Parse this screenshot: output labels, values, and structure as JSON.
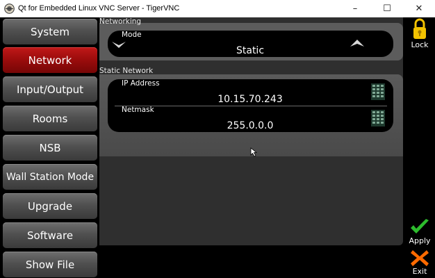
{
  "window": {
    "title": "Qt for Embedded Linux VNC Server - TigerVNC",
    "minimize": "–",
    "maximize": "☐",
    "close": "✕"
  },
  "nav": [
    {
      "label": "System",
      "active": false
    },
    {
      "label": "Network",
      "active": true
    },
    {
      "label": "Input/Output",
      "active": false
    },
    {
      "label": "Rooms",
      "active": false
    },
    {
      "label": "NSB",
      "active": false
    },
    {
      "label": "Wall Station Mode",
      "active": false
    },
    {
      "label": "Upgrade",
      "active": false
    },
    {
      "label": "Software",
      "active": false
    },
    {
      "label": "Show File",
      "active": false
    }
  ],
  "networking": {
    "header": "Networking",
    "mode_label": "Mode",
    "mode_value": "Static"
  },
  "static_network": {
    "header": "Static Network",
    "ip_label": "IP Address",
    "ip_value": "10.15.70.243",
    "netmask_label": "Netmask",
    "netmask_value": "255.0.0.0"
  },
  "side": {
    "lock_label": "Lock",
    "apply_label": "Apply",
    "exit_label": "Exit"
  },
  "colors": {
    "active_nav": "#a00f0f",
    "lock": "#f2c200",
    "apply": "#2dbb2d",
    "exit": "#ff6a00"
  }
}
